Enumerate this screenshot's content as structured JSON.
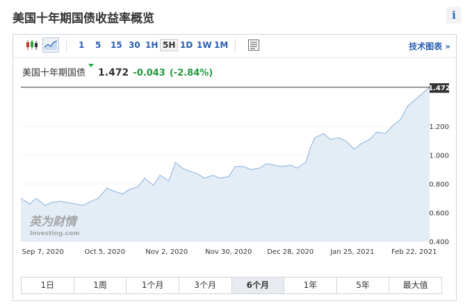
{
  "page": {
    "title": "美国十年期国债收益率概览",
    "info_label": "i"
  },
  "toolbar": {
    "timeframes": [
      "1",
      "5",
      "15",
      "30",
      "1H",
      "5H",
      "1D",
      "1W",
      "1M"
    ],
    "active_timeframe": "5H",
    "tech_chart_label": "技术图表 »",
    "icons": [
      "candlestick-icon",
      "area-chart-icon",
      "settings-icon"
    ]
  },
  "quote": {
    "name": "美国十年期国债",
    "price": "1.472",
    "change": "-0.043",
    "change_pct": "(-2.84%)",
    "change_color": "#1f9a3a",
    "flag_color": "#27a844"
  },
  "watermark": {
    "brand_cn": "英为财情",
    "brand_en": "Investing.com"
  },
  "period_tabs": [
    "1日",
    "1周",
    "1个月",
    "3个月",
    "6个月",
    "1年",
    "5年",
    "最大值"
  ],
  "active_period": "6个月",
  "chart_data": {
    "type": "area",
    "x_ticks": [
      "Sep 7, 2020",
      "Oct 5, 2020",
      "Nov 2, 2020",
      "Nov 30, 2020",
      "Dec 28, 2020",
      "Jan 25, 2021",
      "Feb 22, 2021"
    ],
    "y_ticks": [
      "0.400",
      "0.600",
      "0.800",
      "1.000",
      "1.200"
    ],
    "ylim": [
      0.4,
      1.5
    ],
    "last_value_label": "1.472",
    "reference_lines": [
      1.515,
      1.472
    ],
    "line_color": "#9fbfe0",
    "fill_color": "#e4edf6",
    "series": [
      {
        "x": [
          "2020-08-28",
          "2020-09-01",
          "2020-09-04",
          "2020-09-08",
          "2020-09-11",
          "2020-09-15",
          "2020-09-18",
          "2020-09-22",
          "2020-09-25",
          "2020-09-29",
          "2020-10-02",
          "2020-10-06",
          "2020-10-09",
          "2020-10-13",
          "2020-10-16",
          "2020-10-20",
          "2020-10-23",
          "2020-10-27",
          "2020-10-30",
          "2020-11-03",
          "2020-11-06",
          "2020-11-09",
          "2020-11-12",
          "2020-11-16",
          "2020-11-19",
          "2020-11-23",
          "2020-11-26",
          "2020-11-30",
          "2020-12-03",
          "2020-12-07",
          "2020-12-10",
          "2020-12-14",
          "2020-12-17",
          "2020-12-21",
          "2020-12-24",
          "2020-12-28",
          "2020-12-31",
          "2021-01-04",
          "2021-01-06",
          "2021-01-08",
          "2021-01-12",
          "2021-01-15",
          "2021-01-19",
          "2021-01-22",
          "2021-01-26",
          "2021-01-29",
          "2021-02-02",
          "2021-02-05",
          "2021-02-09",
          "2021-02-12",
          "2021-02-16",
          "2021-02-19",
          "2021-02-22",
          "2021-02-25",
          "2021-03-01"
        ],
        "values": [
          0.7,
          0.66,
          0.7,
          0.65,
          0.67,
          0.68,
          0.67,
          0.66,
          0.65,
          0.68,
          0.7,
          0.77,
          0.75,
          0.73,
          0.76,
          0.78,
          0.84,
          0.79,
          0.86,
          0.82,
          0.95,
          0.91,
          0.89,
          0.87,
          0.84,
          0.86,
          0.84,
          0.85,
          0.92,
          0.92,
          0.9,
          0.91,
          0.94,
          0.93,
          0.92,
          0.93,
          0.91,
          0.95,
          1.05,
          1.12,
          1.15,
          1.11,
          1.12,
          1.1,
          1.04,
          1.08,
          1.11,
          1.16,
          1.15,
          1.2,
          1.25,
          1.34,
          1.38,
          1.42,
          1.472
        ]
      }
    ]
  }
}
